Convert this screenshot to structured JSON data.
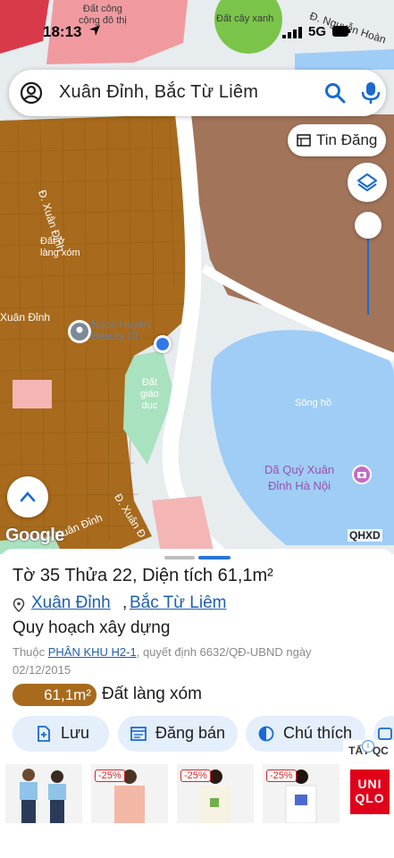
{
  "status_bar": {
    "time": "18:13",
    "network": "5G"
  },
  "map": {
    "labels": {
      "dat_cong_cong": "Đất công\ncộng đô thị",
      "dat_cay_xanh": "Đất cây xanh",
      "duong_nguyen_hoang": "Đ. Nguyễn Hoàn",
      "duong_xuan_dinh_1": "Đ. Xuân Đỉnh",
      "dat_lang_xom": "Đất ở\nlàng xóm",
      "xuan_dinh_left": "Xuân Đỉnh",
      "beauty_poi": "Ngọc Huyền\nBeauty Cl",
      "dat_giao_duc": "Đất\ngiáo\ndục",
      "song_ho": "Sông hồ",
      "da_quy": "Dã Quỳ Xuân\nĐỉnh Hà Nội",
      "duong_xuan_dinh_2": "Đ. Xuân Đ",
      "xuan_dinh_bottom": "Xuân Đỉnh",
      "google": "Google",
      "qhxd": "QHXD",
      "duong_45": "Đ"
    }
  },
  "search": {
    "value": "Xuân Đỉnh, Bắc Từ Liêm"
  },
  "controls": {
    "tin_dang": "Tin Đăng"
  },
  "sheet": {
    "title": "Tờ 35 Thửa 22, Diện tích 61,1m²",
    "ward": "Xuân Đỉnh",
    "comma": ",",
    "district": "Bắc Từ Liêm",
    "plan_title": "Quy hoạch xây dựng",
    "plan_prefix": "Thuộc ",
    "plan_link": "PHÂN KHU H2-1",
    "plan_suffix": ", quyết định 6632/QĐ-UBND ngày 02/12/2015",
    "area": "61,1m²",
    "land_type": "Đất làng xóm",
    "actions": [
      {
        "label": "Lưu"
      },
      {
        "label": "Đăng bán"
      },
      {
        "label": "Chú thích"
      }
    ]
  },
  "ad": {
    "tag": "TẤT QC",
    "discounts": [
      "-25%",
      "-25%",
      "-25%"
    ],
    "brand": "UNI\nQLO"
  },
  "colors": {
    "residential": "#a86a1c",
    "water": "#9fcdf5",
    "education": "#a9e2bf",
    "public": "#f2a0a0",
    "green": "#7bc44a",
    "dark_brown": "#a2745a",
    "accent_blue": "#1a6ad1"
  }
}
